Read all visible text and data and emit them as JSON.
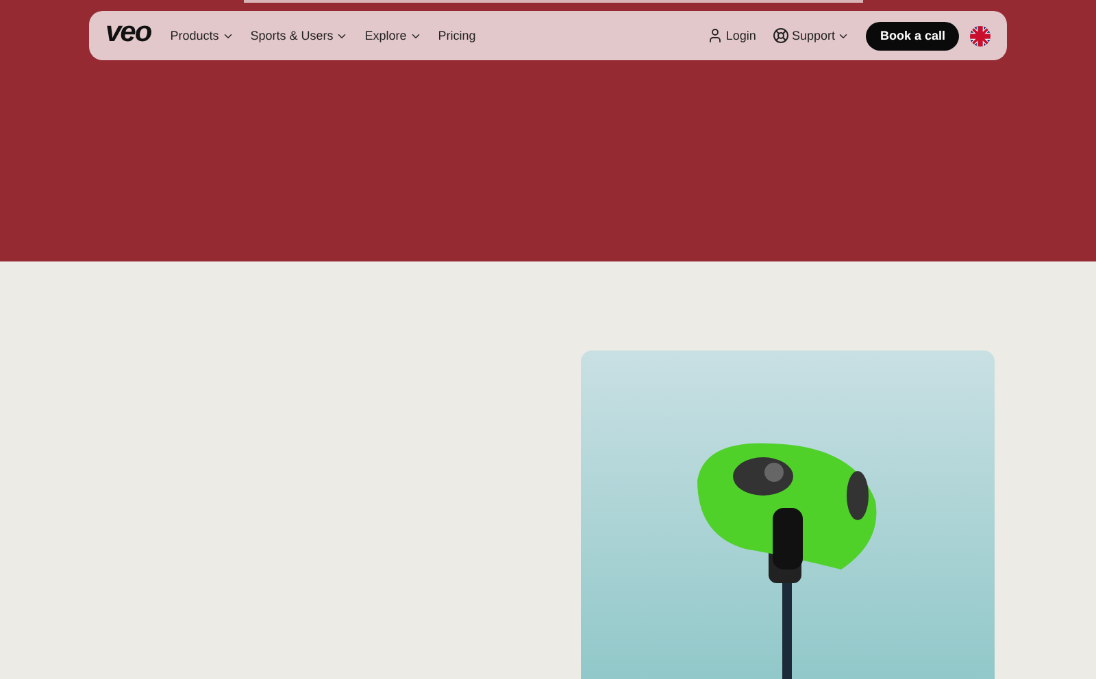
{
  "nav": {
    "logo": "veo",
    "menu": [
      {
        "label": "Products",
        "dropdown": true
      },
      {
        "label": "Sports & Users",
        "dropdown": true
      },
      {
        "label": "Explore",
        "dropdown": true
      },
      {
        "label": "Pricing",
        "dropdown": false
      }
    ],
    "login": "Login",
    "support": {
      "label": "Support",
      "dropdown": true
    },
    "cta": "Book a call"
  }
}
